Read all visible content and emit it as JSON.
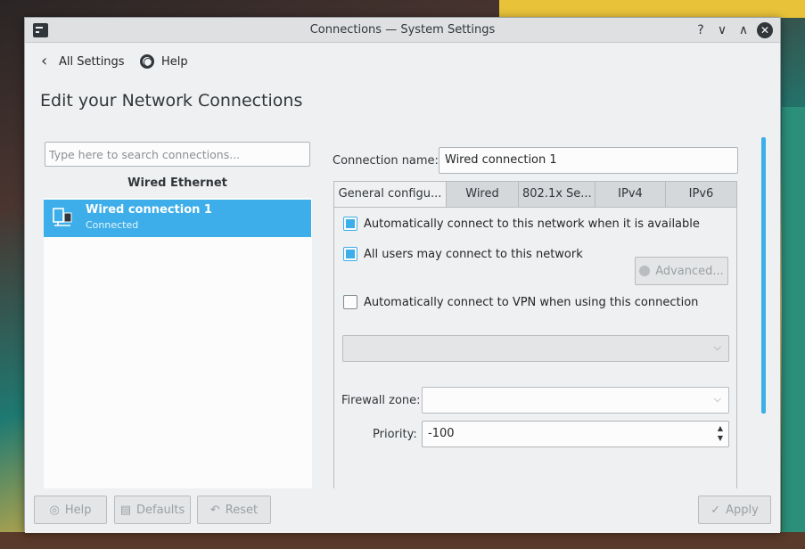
{
  "window": {
    "title": "Connections — System Settings",
    "controls": {
      "help": "?",
      "minimize": "∨",
      "maximize": "∧",
      "close": "✕"
    }
  },
  "nav": {
    "back_label": "All Settings",
    "help_label": "Help"
  },
  "page": {
    "title": "Edit your Network Connections"
  },
  "search": {
    "placeholder": "Type here to search connections..."
  },
  "connections": {
    "group_label": "Wired Ethernet",
    "items": [
      {
        "name": "Wired connection 1",
        "status": "Connected"
      }
    ]
  },
  "form": {
    "connection_name_label": "Connection name:",
    "connection_name_value": "Wired connection 1",
    "tabs": [
      "General configu...",
      "Wired",
      "802.1x Se...",
      "IPv4",
      "IPv6"
    ],
    "auto_connect_label": "Automatically connect to this network when it is available",
    "all_users_label": "All users may connect to this network",
    "advanced_label": "Advanced...",
    "vpn_label": "Automatically connect to VPN when using this connection",
    "firewall_label": "Firewall zone:",
    "firewall_value": "",
    "priority_label": "Priority:",
    "priority_value": "-100"
  },
  "checkbox_states": {
    "auto_connect": true,
    "all_users": true,
    "vpn": false
  },
  "footer": {
    "help": "Help",
    "defaults": "Defaults",
    "reset": "Reset",
    "apply": "Apply"
  },
  "colors": {
    "accent": "#3daee9",
    "window_bg": "#eff0f1",
    "text": "#31363b"
  }
}
